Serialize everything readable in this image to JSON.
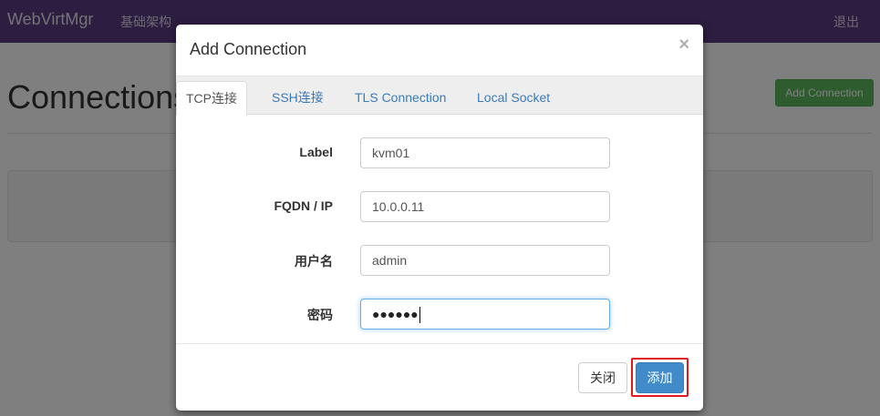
{
  "navbar": {
    "brand": "WebVirtMgr",
    "infrastructure_link": "基础架构",
    "logout_link": "退出"
  },
  "page": {
    "title": "Connections",
    "add_button_label": "Add Connection"
  },
  "modal": {
    "title": "Add Connection",
    "close_symbol": "×",
    "tabs": [
      {
        "label": "TCP连接",
        "active": true
      },
      {
        "label": "SSH连接",
        "active": false
      },
      {
        "label": "TLS Connection",
        "active": false
      },
      {
        "label": "Local Socket",
        "active": false
      }
    ],
    "fields": {
      "label": {
        "label": "Label",
        "value": "kvm01"
      },
      "fqdn": {
        "label": "FQDN / IP",
        "value": "10.0.0.11"
      },
      "username": {
        "label": "用户名",
        "value": "admin"
      },
      "password": {
        "label": "密码",
        "value": "●●●●●●"
      }
    },
    "buttons": {
      "close": "关闭",
      "add": "添加"
    }
  },
  "colors": {
    "navbar": "#5a3a82",
    "primary": "#428bca",
    "success": "#5cb85c",
    "highlight": "#e01b1b"
  }
}
